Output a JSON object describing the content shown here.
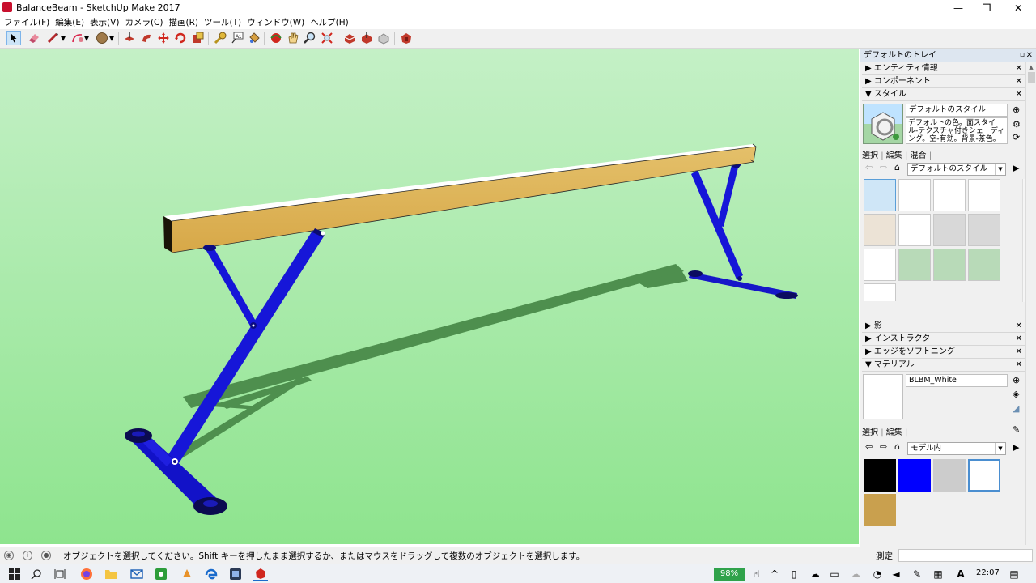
{
  "window": {
    "title": "BalanceBeam - SketchUp Make 2017",
    "minimize": "—",
    "maximize": "❐",
    "close": "✕"
  },
  "menu": [
    "ファイル(F)",
    "編集(E)",
    "表示(V)",
    "カメラ(C)",
    "描画(R)",
    "ツール(T)",
    "ウィンドウ(W)",
    "ヘルプ(H)"
  ],
  "tray": {
    "title": "デフォルトのトレイ",
    "sections": {
      "entity_info": "エンティティ情報",
      "components": "コンポーネント",
      "styles": "スタイル",
      "shadows": "影",
      "instructor": "インストラクタ",
      "soften_edges": "エッジをソフトニング",
      "materials": "マテリアル"
    },
    "style_name": "デフォルトのスタイル",
    "style_desc": "デフォルトの色。面スタイル-テクスチャ付きシェーディング。空-有効。背景-茶色。輪",
    "style_tabs": [
      "選択",
      "編集",
      "混合"
    ],
    "style_combo": "デフォルトのスタイル",
    "material_name": "BLBM_White",
    "material_tabs": [
      "選択",
      "編集"
    ],
    "material_combo": "モデル内",
    "swatch_colors": [
      "#000000",
      "#0000ff",
      "#cccccc",
      "#ffffff",
      "#c9a04e"
    ]
  },
  "status": {
    "message": "オブジェクトを選択してください。Shift キーを押したまま選択するか、またはマウスをドラッグして複数のオブジェクトを選択します。",
    "measure_label": "測定",
    "measure_value": ""
  },
  "taskbar": {
    "battery": "98%",
    "clock": "22:07",
    "ime": "A"
  },
  "icons": {
    "select": "select-arrow-icon",
    "eraser": "eraser-icon",
    "pencil": "line-icon",
    "arc": "arc-icon",
    "shape": "shape-icon",
    "pushpull": "pushpull-icon",
    "followme": "followme-icon",
    "move": "move-icon",
    "rotate": "rotate-icon",
    "scale": "scale-icon",
    "tape": "tape-measure-icon",
    "text": "text-icon",
    "paint": "paint-bucket-icon",
    "orbit": "orbit-icon",
    "pan": "pan-icon",
    "zoom": "zoom-icon",
    "zoomext": "zoom-extents-icon",
    "warehouse": "3d-warehouse-icon",
    "share": "share-model-icon",
    "component": "get-component-icon",
    "ext": "extension-warehouse-icon"
  }
}
